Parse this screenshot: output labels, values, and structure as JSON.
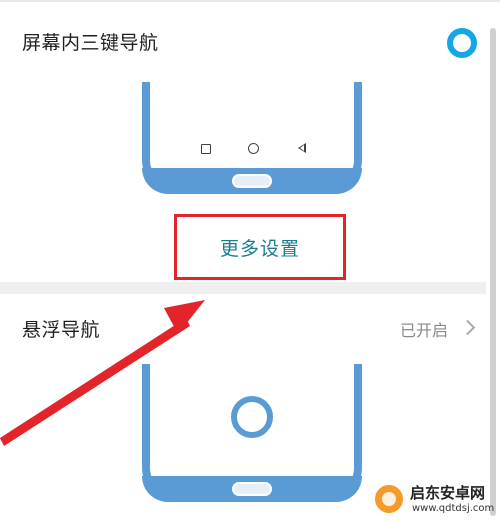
{
  "section1": {
    "title": "屏幕内三键导航"
  },
  "section1_more": {
    "label": "更多设置"
  },
  "section2": {
    "title": "悬浮导航",
    "status": "已开启"
  },
  "watermark": {
    "name": "启东安卓网",
    "url": "www.qdtdsj.com"
  },
  "colors": {
    "accent": "#14a6e6",
    "phone": "#5b9bd5",
    "highlight": "#e3242b",
    "link": "#197f8e"
  }
}
